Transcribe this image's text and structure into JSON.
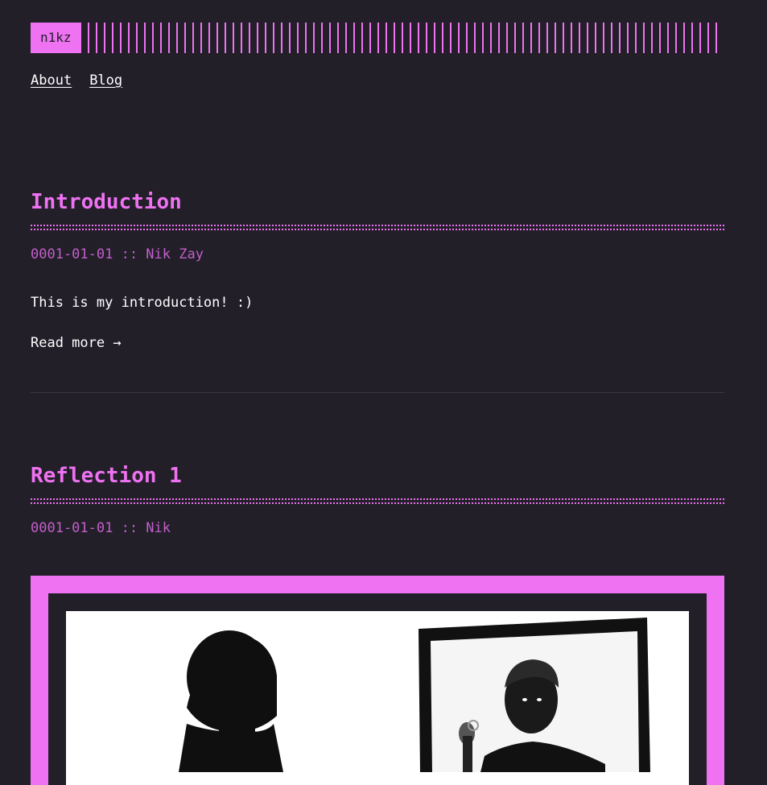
{
  "site": {
    "logo": "n1kz",
    "nav": [
      {
        "label": "About"
      },
      {
        "label": "Blog"
      }
    ]
  },
  "posts": [
    {
      "title": "Introduction",
      "meta": "0001-01-01 :: Nik Zay",
      "body": "This is my introduction! :)",
      "read_more": "Read more →"
    },
    {
      "title": "Reflection 1",
      "meta": "0001-01-01 :: Nik",
      "cover_image": "man-looking-in-mirror"
    }
  ],
  "colors": {
    "background": "#221f29",
    "accent": "#ee72f1",
    "meta": "#c25fc9",
    "text": "#ffffff"
  }
}
